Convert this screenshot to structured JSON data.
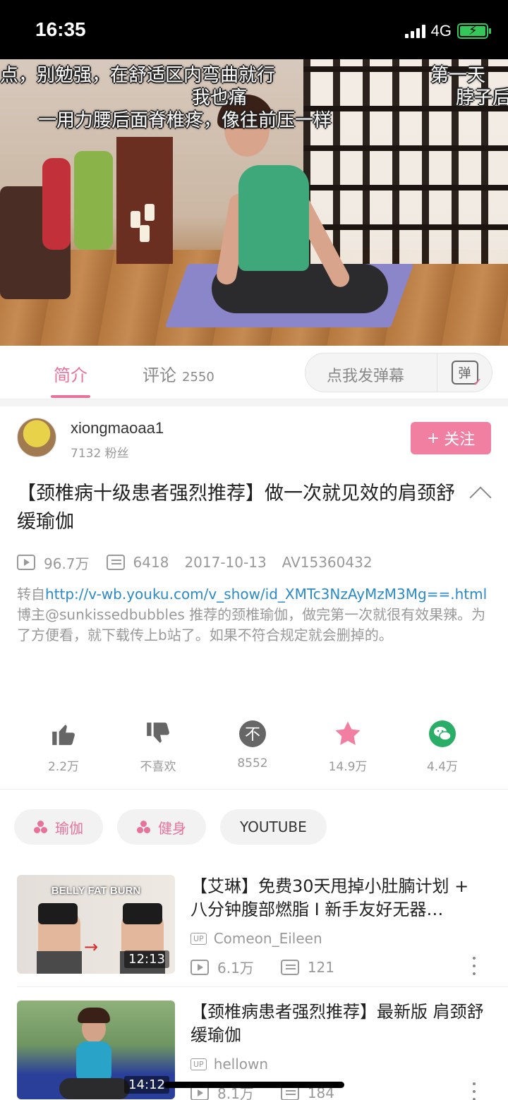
{
  "status_bar": {
    "time": "16:35",
    "network": "4G"
  },
  "video": {
    "subtitles": [
      "点，别勉强，在舒适区内弯曲就行",
      "第一天",
      "我也痛",
      "脖子后",
      "一用力腰后面脊椎疼，像往前压一样"
    ]
  },
  "tabs": {
    "intro": "简介",
    "comments": "评论",
    "comments_count": "2550",
    "danmaku_placeholder": "点我发弹幕",
    "danmaku_icon_text": "弹"
  },
  "uploader": {
    "name": "xiongmaoaa1",
    "fans": "7132 粉丝",
    "follow_label": "关注",
    "follow_icon": "+"
  },
  "video_info": {
    "title": "【颈椎病十级患者强烈推荐】做一次就见效的肩颈舒缓瑜伽",
    "views": "96.7万",
    "danmaku_count": "6418",
    "date": "2017-10-13",
    "av": "AV15360432",
    "repost_prefix": "转自",
    "repost_link": "http://v-wb.youku.com/v_show/id_XMTc3NzAyMzM3Mg==.html",
    "description": "博主@sunkissedbubbles  推荐的颈椎瑜伽，做完第一次就很有效果辣。为了方便看，就下载传上b站了。如果不符合规定就会删掉的。"
  },
  "actions": [
    {
      "icon": "thumbs-up-icon",
      "label": "2.2万"
    },
    {
      "icon": "thumbs-down-icon",
      "label": "不喜欢"
    },
    {
      "icon": "coin-icon",
      "label": "8552"
    },
    {
      "icon": "star-icon",
      "label": "14.9万"
    },
    {
      "icon": "wechat-icon",
      "label": "4.4万"
    }
  ],
  "tags": [
    "瑜伽",
    "健身",
    "YOUTUBE"
  ],
  "recommendations": [
    {
      "title": "【艾琳】免费30天甩掉小肚腩计划 + 八分钟腹部燃脂 I 新手友好无器…",
      "uploader": "Comeon_Eileen",
      "views": "6.1万",
      "danmaku": "121",
      "duration": "12:13",
      "thumb_text": "BELLY FAT BURN"
    },
    {
      "title": "【颈椎病患者强烈推荐】最新版 肩颈舒缓瑜伽",
      "uploader": "hellown",
      "views": "8.1万",
      "danmaku": "184",
      "duration": "14:12"
    }
  ],
  "up_badge": "UP",
  "colors": {
    "accent": "#e8729a",
    "follow_bg": "#f07fa2",
    "link": "#2a8ac6",
    "coin": "#666666",
    "wechat": "#2aae67"
  }
}
